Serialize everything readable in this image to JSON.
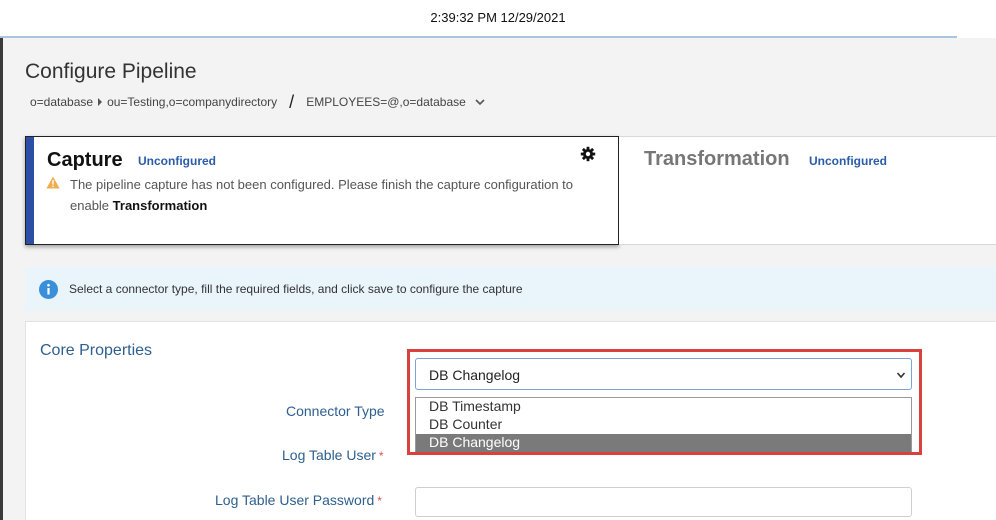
{
  "clock": "2:39:32 PM 12/29/2021",
  "page": {
    "title": "Configure Pipeline",
    "breadcrumb": {
      "root": "o=database",
      "child": "ou=Testing,o=companydirectory",
      "target": "EMPLOYEES=@,o=database"
    }
  },
  "capture": {
    "title": "Capture",
    "status": "Unconfigured",
    "warning_text": "The pipeline capture has not been configured. Please finish the capture configuration to enable ",
    "warning_bold": "Transformation",
    "gear_icon": "gear-icon"
  },
  "transformation": {
    "title": "Transformation",
    "status": "Unconfigured"
  },
  "info": {
    "text": "Select a connector type, fill the required fields, and click save to configure the capture"
  },
  "core": {
    "title": "Core Properties",
    "connector_label": "Connector Type",
    "connector_value": "DB Changelog",
    "log_user_label": "Log Table User",
    "log_password_label": "Log Table User Password",
    "required_mark": "*",
    "options": [
      "DB Timestamp",
      "DB Counter",
      "DB Changelog"
    ]
  },
  "colors": {
    "accent": "#2c4fa6",
    "status": "#2b5ca8",
    "highlight": "#d9413f",
    "selected_option": "#7a7a7a"
  }
}
